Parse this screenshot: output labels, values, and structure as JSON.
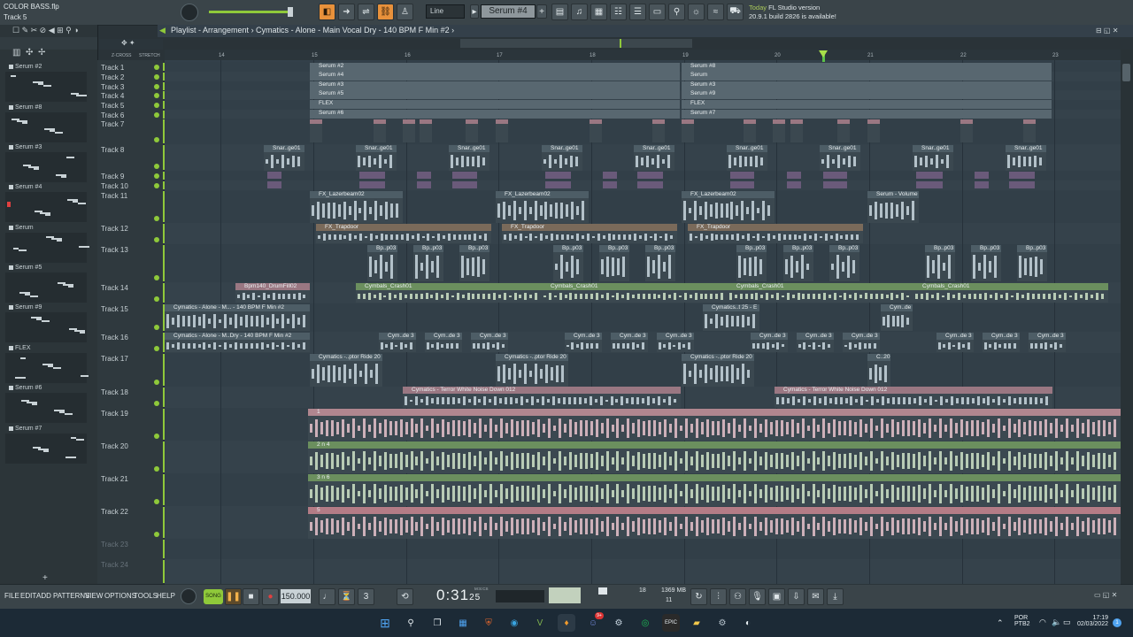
{
  "window": {
    "filename": "COLOR BASS.flp",
    "hint_track": "Track 5"
  },
  "toolbar": {
    "snap": "Line",
    "channel_selector": "Serum #4",
    "news_line1": "Today",
    "news_title": "FL Studio version",
    "news_line2": "20.9.1 build 2826 is available!"
  },
  "playlist": {
    "title": "Playlist - Arrangement",
    "breadcrumb": "› Cymatics - Alone - Main Vocal Dry - 140 BPM F Min #2 ›",
    "ruler": [
      "14",
      "15",
      "16",
      "17",
      "18",
      "19",
      "20",
      "21",
      "22",
      "23"
    ],
    "hdr_left": "Z-CROSS",
    "hdr_right": "STRETCH"
  },
  "browser": {
    "patterns": [
      "Serum #2",
      "Serum #8",
      "Serum #3",
      "Serum #4",
      "Serum",
      "Serum #5",
      "Serum #9",
      "FLEX",
      "Serum #6",
      "Serum #7"
    ]
  },
  "tracks": [
    "Track 1",
    "Track 2",
    "Track 3",
    "Track 4",
    "Track 5",
    "Track 6",
    "Track 7",
    "Track 8",
    "Track 9",
    "Track 10",
    "Track 11",
    "Track 12",
    "Track 13",
    "Track 14",
    "Track 15",
    "Track 16",
    "Track 17",
    "Track 18",
    "Track 19",
    "Track 20",
    "Track 21",
    "Track 22",
    "Track 23",
    "Track 24"
  ],
  "clips": {
    "serum2": "Serum #2",
    "serum8": "Serum #8",
    "serum4": "Serum #4",
    "serum": "Serum",
    "serum3": "Serum #3",
    "serum3b": "Serum #3",
    "serum5": "Serum #5",
    "serum9": "Serum #9",
    "flex": "FLEX",
    "serum6": "Serum #6",
    "serum7": "Serum #7",
    "snare": "Snar..ge01",
    "lazer": "FX_Lazerbeam02",
    "volume": "Serum - Volume",
    "trapdoor": "FX_Trapdoor",
    "bp": "Bp..p03",
    "drumfill": "Bpm140_DrumFill02",
    "cymbals": "Cymbals_Crash01",
    "alone1": "Cymatics - Alone - M... - 140 BPM F Min #2",
    "alone2": "Cymatics - Alone - M..Dry - 140 BPM F Min #2",
    "cyml25": "Cymatics..t 25 - E",
    "cymde": "Cym..de 3",
    "ride": "Cymatics -..ptor Ride 20",
    "c20": "C..20",
    "noise": "Cymatics - Terror White Noise Down 012",
    "c1": "1",
    "c2": "2 n 4",
    "c3": "3 n 6",
    "c5": "5"
  },
  "transport": {
    "menus": [
      "FILE",
      "EDIT",
      "ADD",
      "PATTERNS",
      "VIEW",
      "OPTIONS",
      "TOOLS",
      "HELP"
    ],
    "song_label": "SONG",
    "tempo": "150.000",
    "time": "0:31",
    "time_sub": "25",
    "time_unit": "M:S:CS",
    "cpu": "18",
    "mem": "1369 MB",
    "poly": "11"
  },
  "taskbar": {
    "lang1": "POR",
    "lang2": "PTB2",
    "clock": "17:19",
    "date": "02/03/2022",
    "notif": "1",
    "badge": "9+"
  },
  "colors": {
    "playhead": "#5fd04a",
    "clip_green": "#6b8f5e",
    "clip_pink": "#b08390",
    "accent": "#e8913b"
  }
}
